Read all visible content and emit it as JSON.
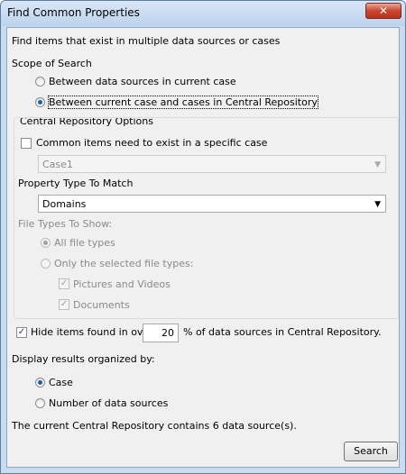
{
  "window": {
    "title": "Find Common Properties",
    "close_glyph": "✕"
  },
  "description": "Find items that exist in multiple data sources or cases",
  "scope": {
    "label": "Scope of Search",
    "option_current_case": "Between data sources in current case",
    "option_central_repo": "Between current case and cases in Central Repository",
    "selected": "central_repo"
  },
  "cr_options": {
    "label": "Central Repository Options",
    "specific_case_label": "Common items need to exist in a specific case",
    "specific_case_checked": false,
    "case_combo_value": "Case1"
  },
  "property_type": {
    "label": "Property Type To Match",
    "value": "Domains"
  },
  "file_types": {
    "label": "File Types To Show:",
    "all_label": "All file types",
    "selected_label": "Only the selected file types:",
    "pictures_label": "Pictures and Videos",
    "documents_label": "Documents",
    "pictures_checked": true,
    "documents_checked": true
  },
  "hide_items": {
    "label": "Hide items found in over",
    "checked": true,
    "value": "20",
    "suffix": "% of data sources in Central Repository."
  },
  "display": {
    "label": "Display results organized by:",
    "option_case": "Case",
    "option_count": "Number of data sources",
    "selected": "case"
  },
  "status_text": "The current Central Repository contains 6 data source(s).",
  "search_button": "Search",
  "icons": {
    "check": "✓",
    "dropdown": "▼"
  },
  "colors": {
    "title_bar": "#c9dcef",
    "close_button": "#c9452f",
    "radio_selected": "#1f5ea8"
  }
}
